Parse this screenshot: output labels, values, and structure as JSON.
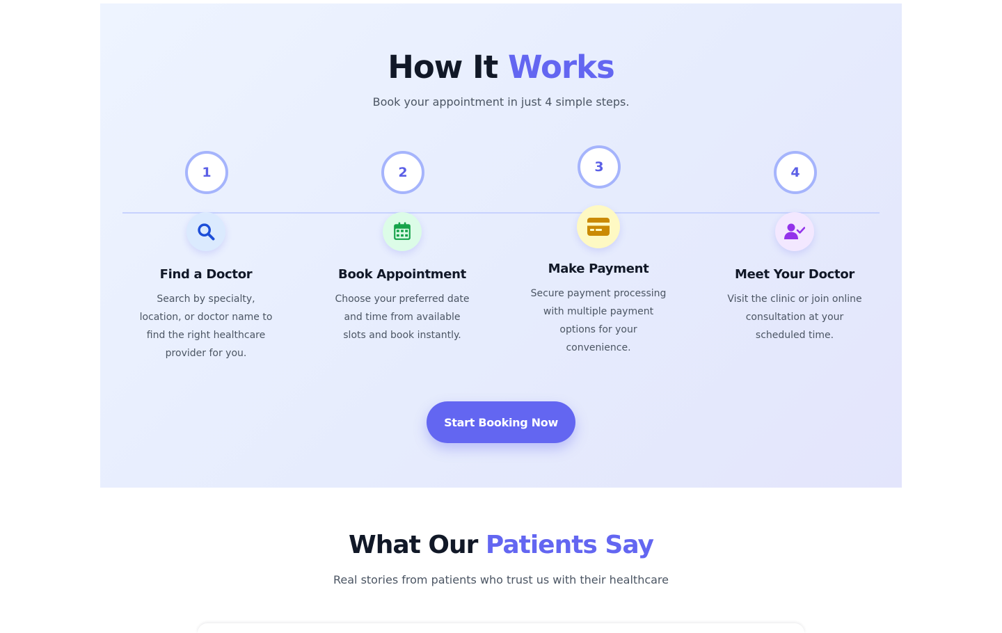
{
  "how_it_works": {
    "title_main": "How It",
    "title_accent": "Works",
    "subtitle": "Book your appointment in just 4 simple steps.",
    "steps": [
      {
        "number": "1",
        "icon": "search-icon",
        "icon_color": "#1d4ed8",
        "icon_bg": "#dbeafe",
        "title": "Find a Doctor",
        "description": "Search by specialty, location, or doctor name to find the right healthcare provider for you."
      },
      {
        "number": "2",
        "icon": "calendar-icon",
        "icon_color": "#16a34a",
        "icon_bg": "#dcfce7",
        "title": "Book Appointment",
        "description": "Choose your preferred date and time from available slots and book instantly."
      },
      {
        "number": "3",
        "icon": "credit-card-icon",
        "icon_color": "#ca8a04",
        "icon_bg": "#fef9c3",
        "title": "Make Payment",
        "description": "Secure payment processing with multiple payment options for your convenience."
      },
      {
        "number": "4",
        "icon": "user-check-icon",
        "icon_color": "#9333ea",
        "icon_bg": "#f3e8ff",
        "title": "Meet Your Doctor",
        "description": "Visit the clinic or join online consultation at your scheduled time."
      }
    ],
    "cta_label": "Start Booking Now"
  },
  "testimonials": {
    "title_main": "What Our",
    "title_accent": "Patients Say",
    "subtitle": "Real stories from patients who trust us with their healthcare"
  },
  "colors": {
    "accent": "#6366f1",
    "heading": "#111827",
    "body_text": "#4b5563",
    "timeline": "#c7d2fe"
  }
}
